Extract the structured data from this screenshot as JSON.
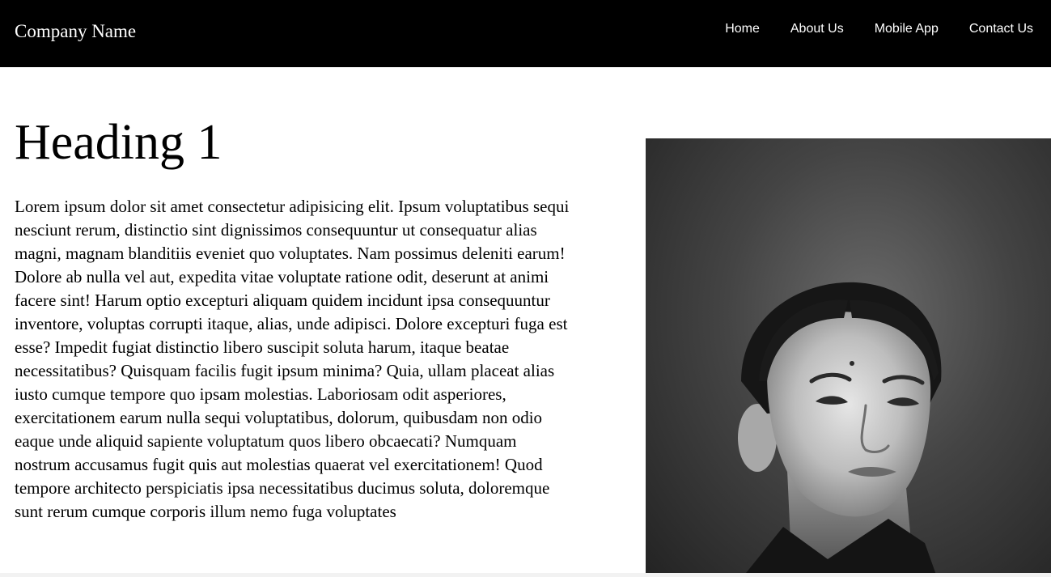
{
  "navbar": {
    "brand": "Company Name",
    "links": [
      "Home",
      "About Us",
      "Mobile App",
      "Contact Us"
    ]
  },
  "main": {
    "heading": "Heading 1",
    "paragraph": "Lorem ipsum dolor sit amet consectetur adipisicing elit. Ipsum voluptatibus sequi nesciunt rerum, distinctio sint dignissimos consequuntur ut consequatur alias magni, magnam blanditiis eveniet quo voluptates. Nam possimus deleniti earum! Dolore ab nulla vel aut, expedita vitae voluptate ratione odit, deserunt at animi facere sint! Harum optio excepturi aliquam quidem incidunt ipsa consequuntur inventore, voluptas corrupti itaque, alias, unde adipisci. Dolore excepturi fuga est esse? Impedit fugiat distinctio libero suscipit soluta harum, itaque beatae necessitatibus? Quisquam facilis fugit ipsum minima? Quia, ullam placeat alias iusto cumque tempore quo ipsam molestias. Laboriosam odit asperiores, exercitationem earum nulla sequi voluptatibus, dolorum, quibusdam non odio eaque unde aliquid sapiente voluptatum quos libero obcaecati? Numquam nostrum accusamus fugit quis aut molestias quaerat vel exercitationem! Quod tempore architecto perspiciatis ipsa necessitatibus ducimus soluta, doloremque sunt rerum cumque corporis illum nemo fuga voluptates"
  },
  "colors": {
    "navbar_background": "#000000",
    "navbar_text": "#ffffff",
    "page_background": "#ffffff",
    "text": "#000000"
  }
}
